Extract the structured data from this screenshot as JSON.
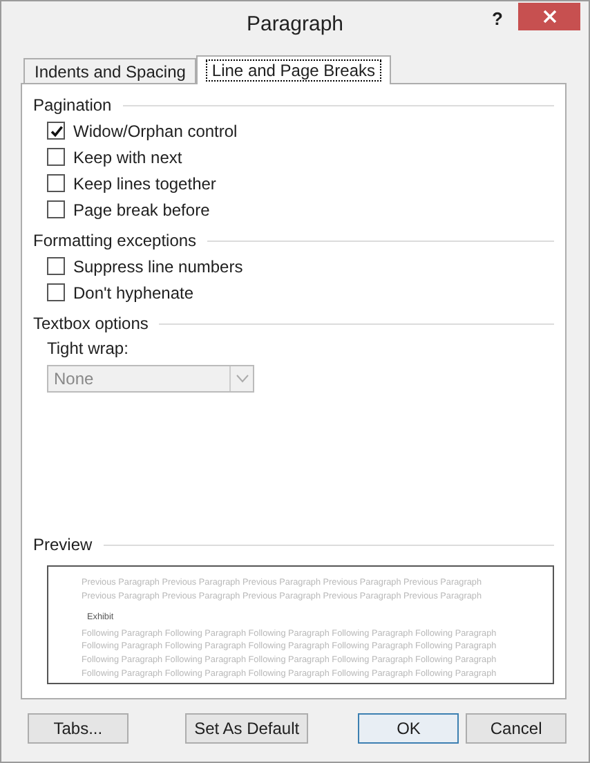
{
  "window": {
    "title": "Paragraph",
    "help": "?"
  },
  "tabs": [
    {
      "label": "Indents and Spacing",
      "selected": false
    },
    {
      "label": "Line and Page Breaks",
      "selected": true
    }
  ],
  "sections": [
    {
      "kind": "checks",
      "title": "Pagination",
      "options": [
        {
          "label": "Widow/Orphan control",
          "checked": true
        },
        {
          "label": "Keep with next",
          "checked": false
        },
        {
          "label": "Keep lines together",
          "checked": false
        },
        {
          "label": "Page break before",
          "checked": false
        }
      ]
    },
    {
      "kind": "checks",
      "title": "Formatting exceptions",
      "options": [
        {
          "label": "Suppress line numbers",
          "checked": false
        },
        {
          "label": "Don't hyphenate",
          "checked": false
        }
      ]
    },
    {
      "kind": "dropdown",
      "title": "Textbox options",
      "field": {
        "label": "Tight wrap:",
        "value": "None",
        "disabled": true
      }
    },
    {
      "kind": "preview",
      "title": "Preview",
      "preview": {
        "previous": [
          "Previous Paragraph Previous Paragraph Previous Paragraph Previous Paragraph Previous Paragraph",
          "Previous Paragraph Previous Paragraph Previous Paragraph Previous Paragraph Previous Paragraph"
        ],
        "sample": "Exhibit",
        "following": [
          "Following Paragraph Following Paragraph Following Paragraph Following Paragraph Following Paragraph",
          "Following Paragraph Following Paragraph Following Paragraph Following Paragraph Following Paragraph",
          "Following Paragraph Following Paragraph Following Paragraph Following Paragraph Following Paragraph",
          "Following Paragraph Following Paragraph Following Paragraph Following Paragraph Following Paragraph"
        ]
      }
    }
  ],
  "buttons": [
    {
      "label": "Tabs...",
      "default": false
    },
    {
      "label": "Set As Default",
      "default": false
    },
    {
      "label": "OK",
      "default": true
    },
    {
      "label": "Cancel",
      "default": false
    }
  ]
}
